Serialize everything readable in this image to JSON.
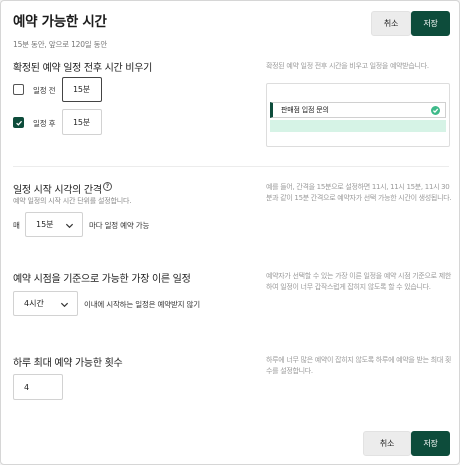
{
  "header": {
    "title": "예약 가능한 시간",
    "subtitle": "15분 동안, 앞으로 120일 동안",
    "cancel_label": "취소",
    "save_label": "저장"
  },
  "buffer": {
    "title": "확정된 예약 일정 전후 시간 비우기",
    "description": "확정된 예약 일정 전후 시간을 비우고 일정을 예약받습니다.",
    "before": {
      "label": "일정 전",
      "checked": false,
      "value": "15분"
    },
    "after": {
      "label": "일정 후",
      "checked": true,
      "value": "15분"
    },
    "preview_event": "판매점 입점 문의"
  },
  "interval": {
    "title": "일정 시작 시각의 간격",
    "subtitle": "예약 일정의 시작 시간 단위를 설정합니다.",
    "prefix": "매",
    "selected": "15분",
    "suffix": "마다 일정 예약 가능",
    "description": "예를 들어, 간격을 15분으로 설정하면 11시, 11시 15분, 11시 30분과 같이 15분 간격으로 예약자가 선택 가능한 시간이 생성됩니다."
  },
  "earliest": {
    "title": "예약 시점을 기준으로 가능한 가장 이른 일정",
    "selected": "4시간",
    "suffix": "이내에 시작하는 일정은 예약받지 않기",
    "description": "예약자가 선택할 수 있는 가장 이른 일정을 예약 시점 기준으로 제한하여 일정이 너무 갑작스럽게 잡히지 않도록 할 수 있습니다."
  },
  "daily_max": {
    "title": "하루 최대 예약 가능한 횟수",
    "value": "4",
    "description": "하루에 너무 많은 예약이 잡히지 않도록 하루에 예약을 받는 최대 횟수를 설정합니다."
  },
  "footer": {
    "cancel_label": "취소",
    "save_label": "저장"
  },
  "colors": {
    "primary": "#0d4c3b",
    "check_green": "#3fba8a",
    "mint": "#d6f3e6"
  }
}
